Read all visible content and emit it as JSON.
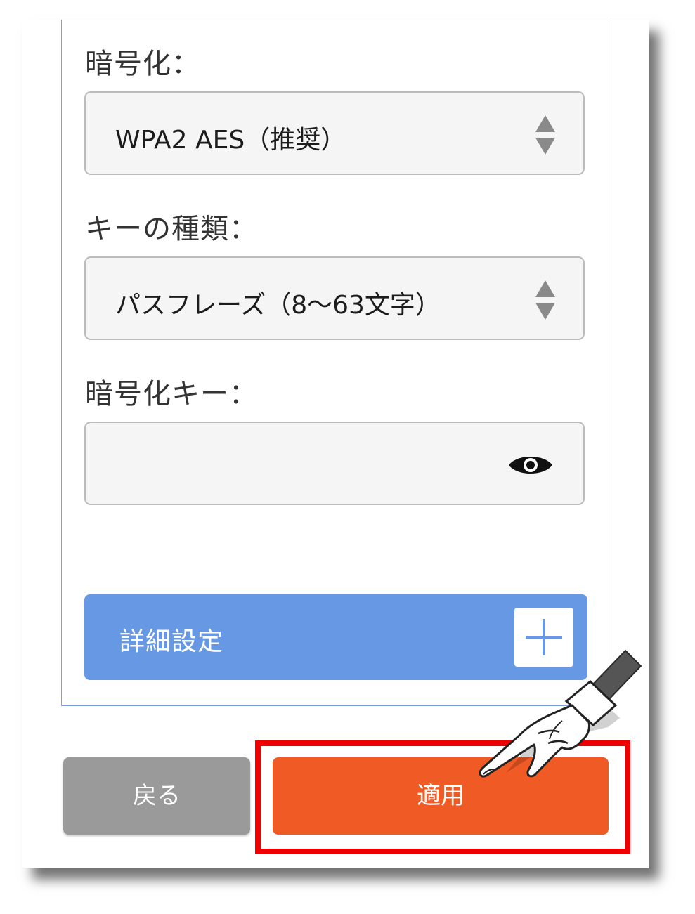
{
  "form": {
    "encryption": {
      "label": "暗号化：",
      "selected": "WPA2 AES（推奨）"
    },
    "key_type": {
      "label": "キーの種類：",
      "selected": "パスフレーズ（8〜63文字）"
    },
    "encryption_key": {
      "label": "暗号化キー：",
      "value": "",
      "toggle_icon": "eye-icon"
    },
    "advanced": {
      "label": "詳細設定",
      "icon": "plus-icon"
    }
  },
  "actions": {
    "back_label": "戻る",
    "apply_label": "適用"
  },
  "colors": {
    "panel_border": "#7d9fde",
    "advanced_bar": "#6798e3",
    "back_button": "#9a9a9a",
    "apply_button": "#f05a24",
    "highlight": "#ee0000"
  }
}
